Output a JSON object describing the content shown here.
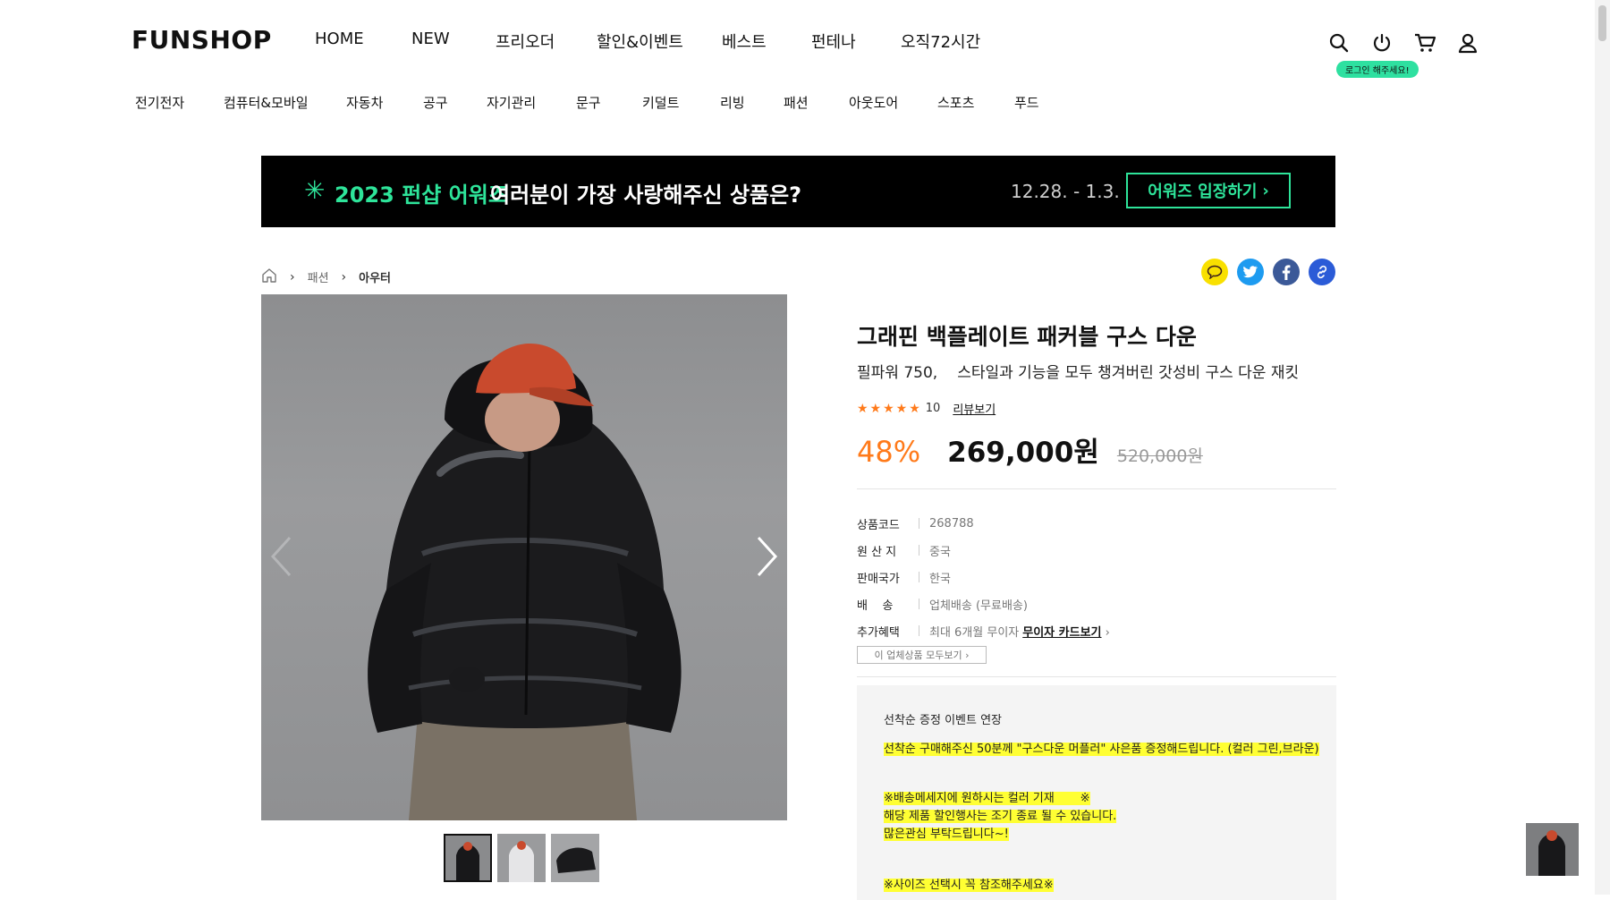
{
  "header": {
    "logo": "FUNSHOP",
    "nav": [
      "HOME",
      "NEW",
      "프리오더",
      "할인&이벤트",
      "베스트",
      "펀테나",
      "오직72시간"
    ],
    "icons": [
      "search-icon",
      "power-icon",
      "cart-icon",
      "user-icon"
    ],
    "login_badge": "로그인 해주세요!"
  },
  "categories": [
    "전기전자",
    "컴퓨터&모바일",
    "자동차",
    "공구",
    "자기관리",
    "문구",
    "키덜트",
    "리빙",
    "패션",
    "아웃도어",
    "스포츠",
    "푸드"
  ],
  "banner": {
    "highlight": "2023 펀샵 어워즈",
    "text": "여러분이 가장 사랑해주신 상품은?",
    "date": "12.28. - 1.3.",
    "cta": "어워즈 입장하기"
  },
  "breadcrumb": [
    "패션",
    "아우터"
  ],
  "share_icons": [
    "kakao-icon",
    "twitter-icon",
    "facebook-icon",
    "link-icon"
  ],
  "product": {
    "title": "그래핀 백플레이트 패커블 구스 다운",
    "subtitle_a": "필파워 750,",
    "subtitle_b": "스타일과 기능을 모두 챙겨버린 갓성비 구스 다운 재킷",
    "rating_stars": 5,
    "review_count": "10",
    "review_link": "리뷰보기",
    "discount": "48%",
    "price": "269,000원",
    "original_price": "520,000원"
  },
  "specs": [
    {
      "key": "상품코드",
      "value": "268788"
    },
    {
      "key": "원 산 지",
      "value": "중국"
    },
    {
      "key": "판매국가",
      "value": "한국"
    },
    {
      "key": "배    송",
      "value": "업체배송 (무료배송)"
    },
    {
      "key": "추가혜택",
      "value": "최대 6개월 무이자",
      "link": "무이자 카드보기"
    }
  ],
  "all_products_button": "이 업체상품 모두보기",
  "notice": {
    "title": "선착순 증정 이벤트 연장",
    "line1": "선착순 구매해주신 50분께 \"구스다운 머플러\" 사은품 증정해드립니다. (컬러 그린,브라운)",
    "line2": "※배송메세지에 원하시는 컬러 기재       ※",
    "line3": "해당 제품 할인행사는 조기 종료 될 수 있습니다.",
    "line4": "많은관심 부탁드립니다~!",
    "line5": "※사이즈 선택시 꼭 참조해주세요※"
  }
}
